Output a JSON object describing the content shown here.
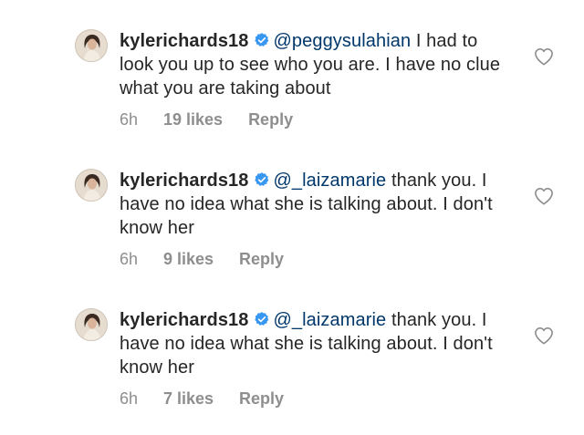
{
  "comments": [
    {
      "username": "kylerichards18",
      "mention": "@peggysulahian",
      "text": " I had to look you up to see who you are. I have no clue what you are taking about",
      "time": "6h",
      "likes": "19 likes",
      "reply": "Reply"
    },
    {
      "username": "kylerichards18",
      "mention": "@_laizamarie",
      "text": " thank you. I have no idea what she is talking about. I don't know her",
      "time": "6h",
      "likes": "9 likes",
      "reply": "Reply"
    },
    {
      "username": "kylerichards18",
      "mention": "@_laizamarie",
      "text": " thank you. I have no idea what she is talking about. I don't know her",
      "time": "6h",
      "likes": "7 likes",
      "reply": "Reply"
    }
  ],
  "icons": {
    "verified": "verified-badge-icon",
    "like": "heart-outline-icon"
  },
  "colors": {
    "text": "#262626",
    "mention": "#00376b",
    "meta": "#8e8e8e",
    "verified": "#3897f0"
  }
}
